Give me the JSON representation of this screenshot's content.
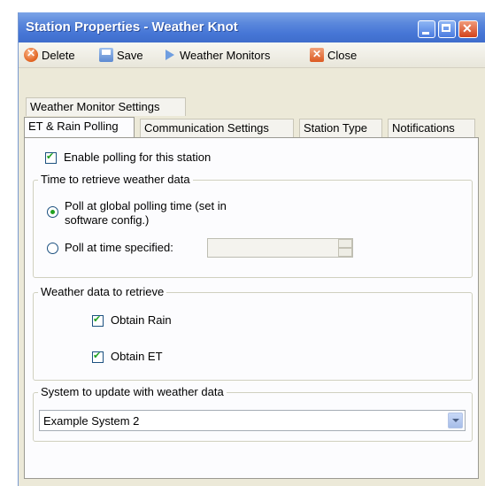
{
  "window": {
    "title": "Station Properties - Weather Knot"
  },
  "toolbar": {
    "delete_label": "Delete",
    "save_label": "Save",
    "weather_monitors_label": "Weather Monitors",
    "close_label": "Close"
  },
  "tabs": {
    "row1": [
      "Weather Monitor Settings"
    ],
    "row2": [
      "ET & Rain Polling",
      "Communication Settings",
      "Station Type",
      "Notifications"
    ],
    "active": "ET & Rain Polling"
  },
  "polling": {
    "enable_label": "Enable polling for this station",
    "enable_checked": true,
    "time_group_title": "Time to retrieve weather data",
    "global_option_line1": "Poll at global polling time (set in",
    "global_option_line2": "software config.)",
    "global_selected": true,
    "specified_option": "Poll at time specified:",
    "specified_time_value": "",
    "data_group_title": "Weather data to retrieve",
    "obtain_rain_label": "Obtain Rain",
    "obtain_rain_checked": true,
    "obtain_et_label": "Obtain ET",
    "obtain_et_checked": true,
    "system_group_title": "System to update with weather data",
    "system_selected": "Example System 2"
  },
  "colors": {
    "title_bar": "#4676d6",
    "window_bg": "#ece9d8",
    "panel_bg": "#fcfcfe",
    "check_mark": "#21a121"
  }
}
